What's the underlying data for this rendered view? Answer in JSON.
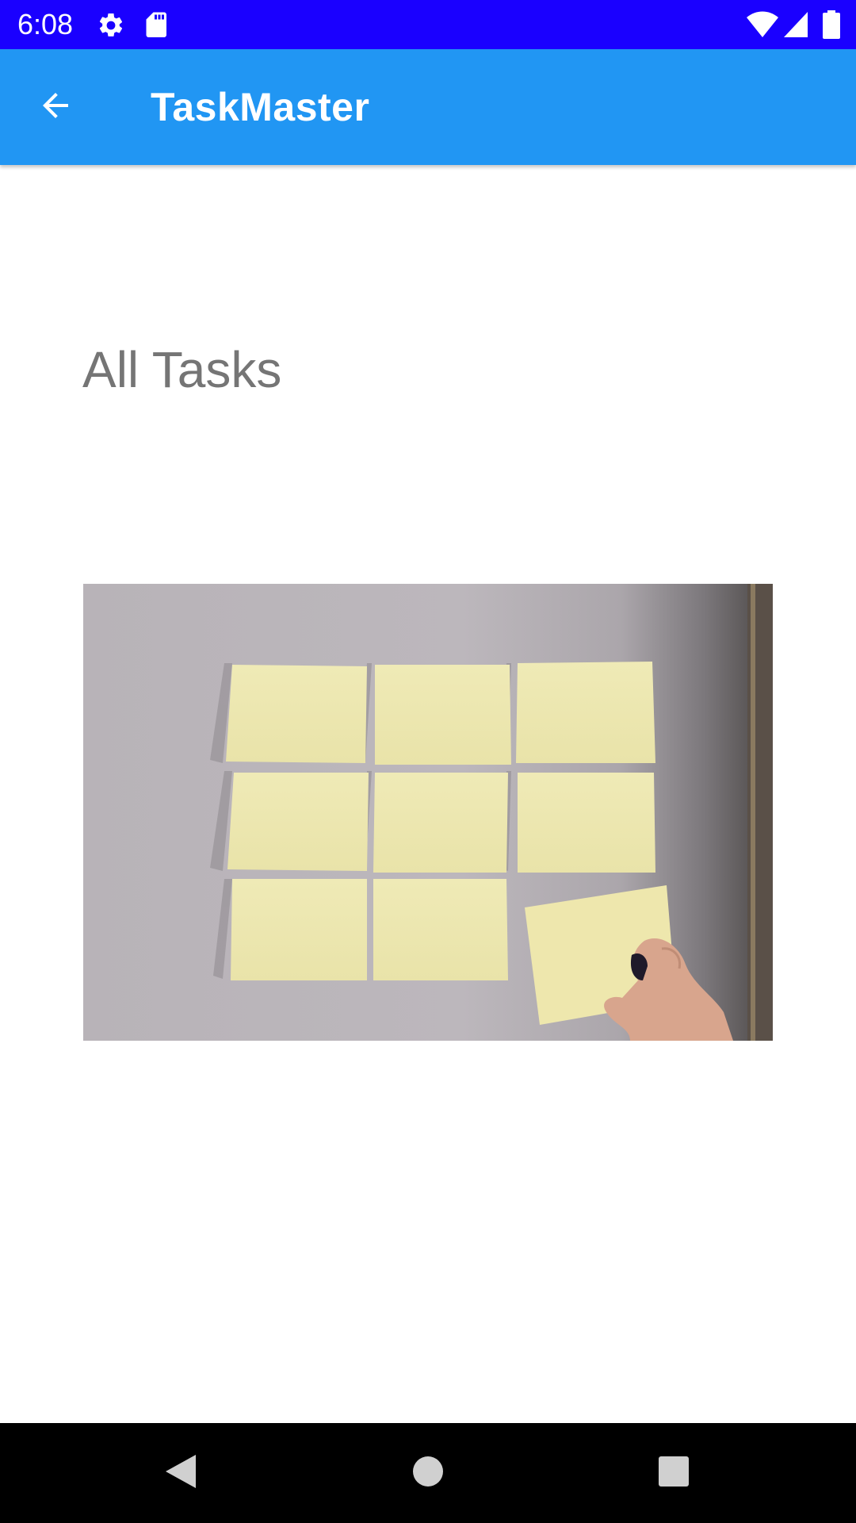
{
  "status_bar": {
    "time": "6:08",
    "background": "#1a00ff",
    "icons": [
      "gear-icon",
      "sd-card-icon",
      "wifi-icon",
      "cell-signal-icon",
      "battery-icon"
    ]
  },
  "app_bar": {
    "title": "TaskMaster",
    "background": "#2196f3",
    "back_icon": "arrow-back-icon"
  },
  "main": {
    "heading": "All Tasks",
    "image": {
      "subject": "sticky-notes-photo",
      "note_color": "#efeab0",
      "wall_color": "#b9b4b8"
    }
  },
  "nav_bar": {
    "buttons": [
      "nav-back-icon",
      "nav-home-icon",
      "nav-recents-icon"
    ]
  }
}
